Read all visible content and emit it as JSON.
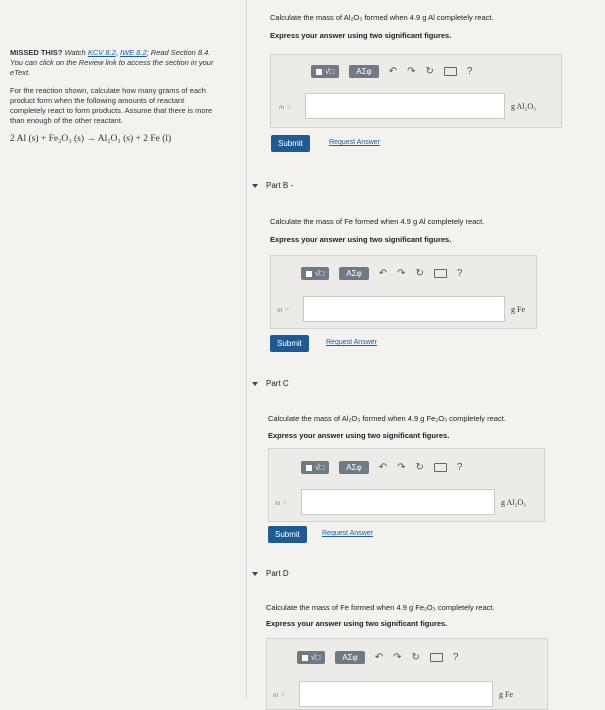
{
  "sidebar": {
    "missed_label": "MISSED THIS?",
    "watch_text": "Watch",
    "kcv_link": "KCV 8.2",
    "iwe_link": "IWE 8.2",
    "read_text": "; Read Section 8.4. You can click on the Review link to access the section in your eText.",
    "instructions": "For the reaction shown, calculate how many grams of each product form when the following amounts of reactant completely react to form products. Assume that there is more than enough of the other reactant.",
    "reaction": "2 Al (s) + Fe₂O₃ (s) → Al₂O₃ (s) + 2 Fe (l)"
  },
  "toolbar": {
    "templates_label": "√□",
    "greek_label": "ΑΣφ",
    "help_label": "?"
  },
  "parts": [
    {
      "id": "A",
      "header": "",
      "question": "Calculate the mass of Al₂O₃ formed when 4.9 g Al completely react.",
      "instruction": "Express your answer using two significant figures.",
      "m_label": "m =",
      "unit": "g Al₂O₃",
      "submit": "Submit",
      "request": "Request Answer",
      "answer": ""
    },
    {
      "id": "B",
      "header": "Part B -",
      "question": "Calculate the mass of Fe formed when 4.9 g Al completely react.",
      "instruction": "Express your answer using two significant figures.",
      "m_label": "m =",
      "unit": "g Fe",
      "submit": "Submit",
      "request": "Request Answer",
      "answer": ""
    },
    {
      "id": "C",
      "header": "Part C",
      "question": "Calculate the mass of Al₂O₃ formed when 4.9 g Fe₂O₃ completely react.",
      "instruction": "Express your answer using two significant figures.",
      "m_label": "m =",
      "unit": "g Al₂O₃",
      "submit": "Submit",
      "request": "Request Answer",
      "answer": ""
    },
    {
      "id": "D",
      "header": "Part D",
      "question": "Calculate the mass of Fe formed when 4.9 g Fe₂O₃ completely react.",
      "instruction": "Express your answer using two significant figures.",
      "m_label": "m =",
      "unit": "g Fe",
      "submit": "",
      "request": "",
      "answer": ""
    }
  ]
}
